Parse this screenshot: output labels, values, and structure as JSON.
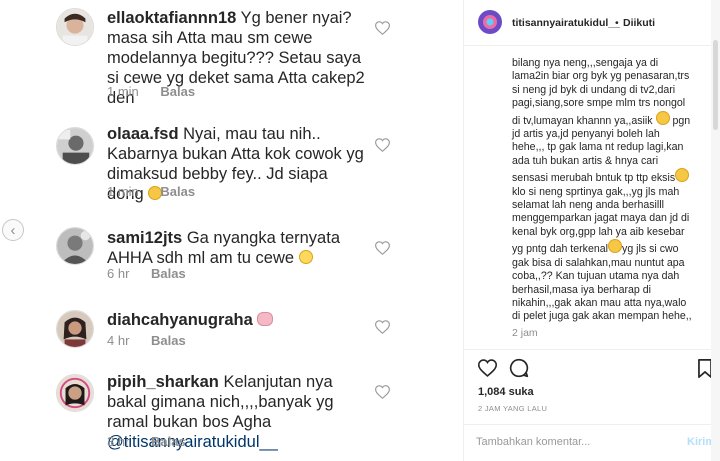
{
  "comments": [
    {
      "username": "ellaoktafiannn18",
      "text": "Yg bener nyai?masa sih Atta mau sm cewe modelannya begitu??? Setau saya si cewe yg deket sama Atta cakep2 deh",
      "time": "1 min",
      "reply": "Balas"
    },
    {
      "username": "olaaa.fsd",
      "text": "Nyai, mau tau nih.. Kabarnya bukan Atta kok cowok yg dimaksud bebby fey.. Jd siapa dong",
      "time": "1 min",
      "reply": "Balas"
    },
    {
      "username": "sami12jts",
      "text": "Ga nyangka ternyata AHHA sdh ml am tu cewe",
      "time": "6 hr",
      "reply": "Balas"
    },
    {
      "username": "diahcahyanugraha",
      "text": "",
      "time": "4 hr",
      "reply": "Balas"
    },
    {
      "username": "pipih_sharkan",
      "text": "Kelanjutan nya bakal gimana nich,,,,banyak yg ramal bukan bos Agha",
      "mention": "@titisannyairatukidul__",
      "time": "3 hr",
      "reply": "Balas"
    }
  ],
  "post": {
    "username": "titisannyairatukidul__",
    "separator": "•",
    "follow_label": "Diikuti",
    "caption_lines": [
      "bilang nya neng,,,sengaja ya di",
      "lama2in biar org byk yg penasaran,trs",
      "si neng jd byk di undang di tv2,dari",
      "pagi,siang,sore smpe mlm trs nongol",
      "di tv,lumayan khannn ya,,asiik",
      "jd artis ya,jd penyanyi boleh lah",
      "hehe,,, tp gak lama nt redup lagi,kan",
      "ada tuh bukan artis & hnya cari",
      "sensasi merubah bntuk tp ttp eksis",
      "klo si neng sprtinya gak,,,yg jls mah",
      "selamat lah neng anda berhasilll",
      "menggemparkan jagat maya dan jd di",
      "kenal byk org,gpp lah ya aib kesebar",
      "yg pntg dah terkenal",
      "gak bisa di salahkan,mau nuntut apa",
      "coba,,?? Kan tujuan utama nya dah",
      "berhasil,masa iya berharap di",
      "nikahin,,,gak akan mau atta nya,walo",
      "di pelet juga gak akan mempan hehe,,"
    ],
    "caption_line_extras": {
      "4": "pgn",
      "13": "yg jls si cwo"
    },
    "caption_time": "2 jam",
    "likes": "1,084 suka",
    "posted_ago": "2 JAM YANG LALU",
    "comment_placeholder": "Tambahkan komentar...",
    "send_label": "Kirim"
  },
  "icons": {
    "nav": "chevron-left-icon",
    "like": "heart-icon",
    "comment": "comment-bubble-icon",
    "save": "bookmark-icon"
  },
  "colors": {
    "text": "#262626",
    "muted": "#8e8e8e",
    "border": "#efefef",
    "send_disabled": "#b2dffc",
    "mention": "#003569"
  }
}
